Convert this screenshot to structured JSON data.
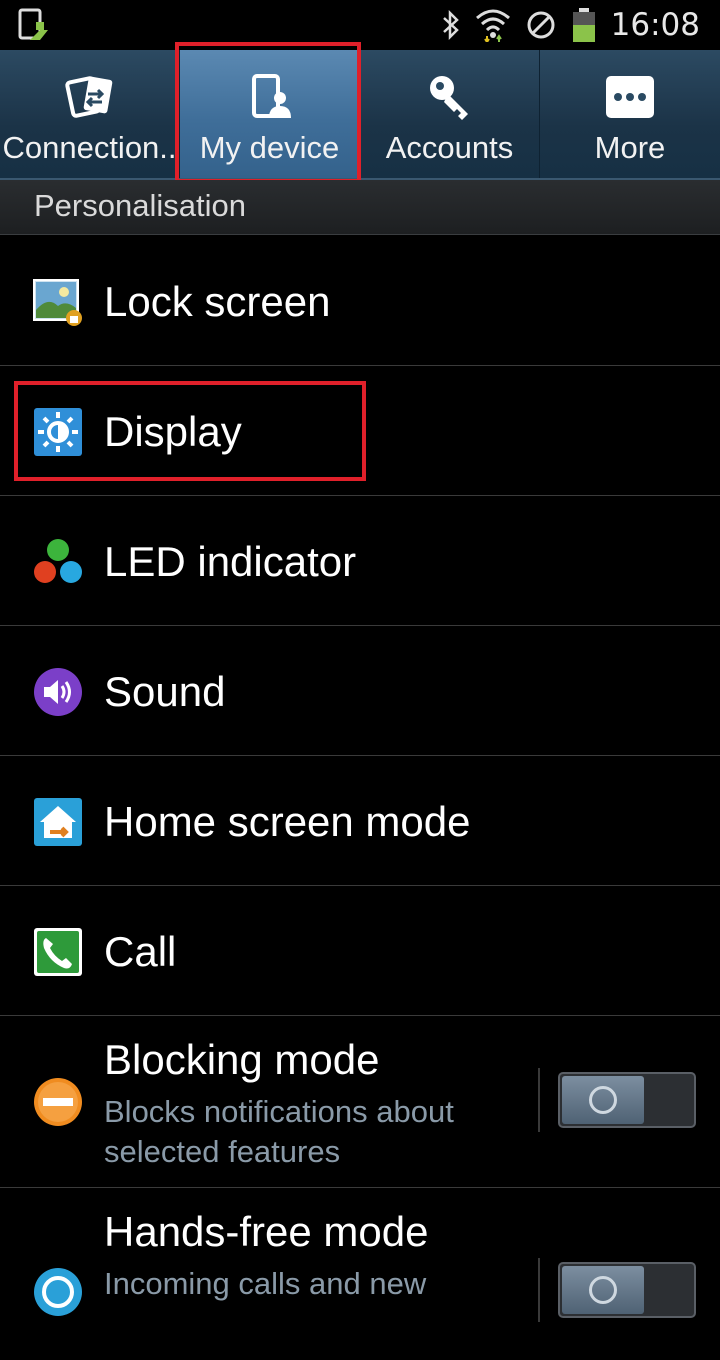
{
  "status_bar": {
    "time": "16:08",
    "icons": [
      "app-update-icon",
      "bluetooth-icon",
      "wifi-icon",
      "no-signal-icon",
      "battery-icon"
    ]
  },
  "tabs": [
    {
      "label": "Connection..",
      "icon": "connections-icon",
      "active": false
    },
    {
      "label": "My device",
      "icon": "my-device-icon",
      "active": true
    },
    {
      "label": "Accounts",
      "icon": "accounts-key-icon",
      "active": false
    },
    {
      "label": "More",
      "icon": "more-dots-icon",
      "active": false
    }
  ],
  "section_header": "Personalisation",
  "items": [
    {
      "title": "Lock screen",
      "icon": "lock-screen-icon"
    },
    {
      "title": "Display",
      "icon": "display-brightness-icon"
    },
    {
      "title": "LED indicator",
      "icon": "led-indicator-icon"
    },
    {
      "title": "Sound",
      "icon": "sound-icon"
    },
    {
      "title": "Home screen mode",
      "icon": "home-screen-icon"
    },
    {
      "title": "Call",
      "icon": "call-icon"
    },
    {
      "title": "Blocking mode",
      "subtitle": "Blocks notifications about selected features",
      "icon": "blocking-mode-icon",
      "toggle": "off"
    },
    {
      "title": "Hands-free mode",
      "subtitle": "Incoming calls and new",
      "icon": "hands-free-icon",
      "toggle": "off"
    }
  ],
  "colors": {
    "highlight": "#e0202a",
    "active_tab": "#4a7aa6",
    "subtitle": "#8a9aa8"
  }
}
